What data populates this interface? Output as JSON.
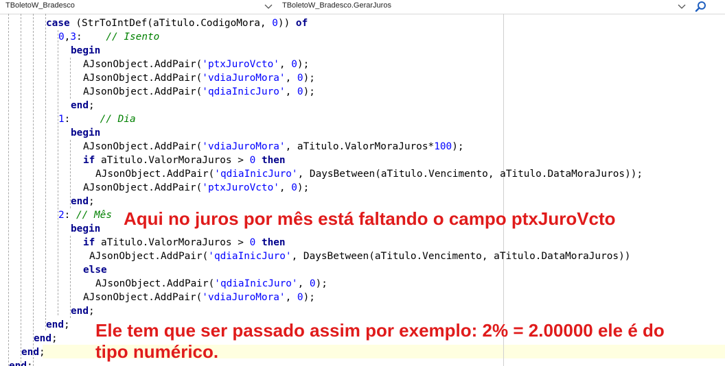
{
  "toolbar": {
    "class_combo_value": "TBoletoW_Bradesco",
    "method_combo_value": "TBoletoW_Bradesco.GerarJuros"
  },
  "code": {
    "lines": [
      {
        "parts": [
          {
            "t": "case",
            "c": "kw"
          },
          {
            "t": " (StrToIntDef(aTitulo.CodigoMora, "
          },
          {
            "t": "0",
            "c": "nm"
          },
          {
            "t": ")) "
          },
          {
            "t": "of",
            "c": "kw"
          }
        ]
      },
      {
        "parts": [
          {
            "t": "0",
            "c": "nm"
          },
          {
            "t": ","
          },
          {
            "t": "3",
            "c": "nm"
          },
          {
            "t": ":    "
          },
          {
            "t": "// Isento",
            "c": "cm"
          }
        ]
      },
      {
        "parts": [
          {
            "t": "begin",
            "c": "kw"
          }
        ]
      },
      {
        "parts": [
          {
            "t": "AJsonObject.AddPair("
          },
          {
            "t": "'ptxJuroVcto'",
            "c": "st"
          },
          {
            "t": ", "
          },
          {
            "t": "0",
            "c": "nm"
          },
          {
            "t": ");"
          }
        ]
      },
      {
        "parts": [
          {
            "t": "AJsonObject.AddPair("
          },
          {
            "t": "'vdiaJuroMora'",
            "c": "st"
          },
          {
            "t": ", "
          },
          {
            "t": "0",
            "c": "nm"
          },
          {
            "t": ");"
          }
        ]
      },
      {
        "parts": [
          {
            "t": "AJsonObject.AddPair("
          },
          {
            "t": "'qdiaInicJuro'",
            "c": "st"
          },
          {
            "t": ", "
          },
          {
            "t": "0",
            "c": "nm"
          },
          {
            "t": ");"
          }
        ]
      },
      {
        "parts": [
          {
            "t": "end",
            "c": "kw"
          },
          {
            "t": ";"
          }
        ]
      },
      {
        "parts": [
          {
            "t": "1",
            "c": "nm"
          },
          {
            "t": ":     "
          },
          {
            "t": "// Dia",
            "c": "cm"
          }
        ]
      },
      {
        "parts": [
          {
            "t": "begin",
            "c": "kw"
          }
        ]
      },
      {
        "parts": [
          {
            "t": "AJsonObject.AddPair("
          },
          {
            "t": "'vdiaJuroMora'",
            "c": "st"
          },
          {
            "t": ", aTitulo.ValorMoraJuros*"
          },
          {
            "t": "100",
            "c": "nm"
          },
          {
            "t": ");"
          }
        ]
      },
      {
        "parts": [
          {
            "t": "if",
            "c": "kw"
          },
          {
            "t": " aTitulo.ValorMoraJuros > "
          },
          {
            "t": "0",
            "c": "nm"
          },
          {
            "t": " "
          },
          {
            "t": "then",
            "c": "kw"
          }
        ]
      },
      {
        "parts": [
          {
            "t": "AJsonObject.AddPair("
          },
          {
            "t": "'qdiaInicJuro'",
            "c": "st"
          },
          {
            "t": ", DaysBetween(aTitulo.Vencimento, aTitulo.DataMoraJuros));"
          }
        ]
      },
      {
        "parts": [
          {
            "t": "AJsonObject.AddPair("
          },
          {
            "t": "'ptxJuroVcto'",
            "c": "st"
          },
          {
            "t": ", "
          },
          {
            "t": "0",
            "c": "nm"
          },
          {
            "t": ");"
          }
        ]
      },
      {
        "parts": [
          {
            "t": "end",
            "c": "kw"
          },
          {
            "t": ";"
          }
        ]
      },
      {
        "parts": [
          {
            "t": "2",
            "c": "nm"
          },
          {
            "t": ": "
          },
          {
            "t": "// Mês",
            "c": "cm"
          }
        ]
      },
      {
        "parts": [
          {
            "t": "begin",
            "c": "kw"
          }
        ]
      },
      {
        "parts": [
          {
            "t": "if",
            "c": "kw"
          },
          {
            "t": " aTitulo.ValorMoraJuros > "
          },
          {
            "t": "0",
            "c": "nm"
          },
          {
            "t": " "
          },
          {
            "t": "then",
            "c": "kw"
          }
        ]
      },
      {
        "parts": [
          {
            "t": "AJsonObject.AddPair("
          },
          {
            "t": "'qdiaInicJuro'",
            "c": "st"
          },
          {
            "t": ", DaysBetween(aTitulo.Vencimento, aTitulo.DataMoraJuros))"
          }
        ]
      },
      {
        "parts": [
          {
            "t": "else",
            "c": "kw"
          }
        ]
      },
      {
        "parts": [
          {
            "t": "AJsonObject.AddPair("
          },
          {
            "t": "'qdiaInicJuro'",
            "c": "st"
          },
          {
            "t": ", "
          },
          {
            "t": "0",
            "c": "nm"
          },
          {
            "t": ");"
          }
        ]
      },
      {
        "parts": [
          {
            "t": "AJsonObject.AddPair("
          },
          {
            "t": "'vdiaJuroMora'",
            "c": "st"
          },
          {
            "t": ", "
          },
          {
            "t": "0",
            "c": "nm"
          },
          {
            "t": ");"
          }
        ]
      },
      {
        "parts": [
          {
            "t": "end",
            "c": "kw"
          },
          {
            "t": ";"
          }
        ]
      },
      {
        "parts": [
          {
            "t": "end",
            "c": "kw"
          },
          {
            "t": ";"
          }
        ]
      },
      {
        "parts": [
          {
            "t": "end",
            "c": "kw"
          },
          {
            "t": ";"
          }
        ]
      },
      {
        "parts": [
          {
            "t": "end",
            "c": "kw"
          },
          {
            "t": ";"
          }
        ]
      },
      {
        "parts": [
          {
            "t": "end",
            "c": "kw"
          },
          {
            "t": ";"
          }
        ]
      }
    ]
  },
  "annotations": {
    "note1": "Aqui no juros por mês está faltando o campo ptxJuroVcto",
    "note2_line1": "Ele tem que ser passado assim por exemplo: 2% = 2.00000 ele é do",
    "note2_line2": "tipo numérico."
  },
  "colors": {
    "keyword": "#00008b",
    "comment": "#008000",
    "string": "#0000ff",
    "annotation": "#e01b1b",
    "current_line": "#ffffe0"
  },
  "icons": {
    "dropdown": "chevron-down-icon",
    "search": "search-icon"
  }
}
